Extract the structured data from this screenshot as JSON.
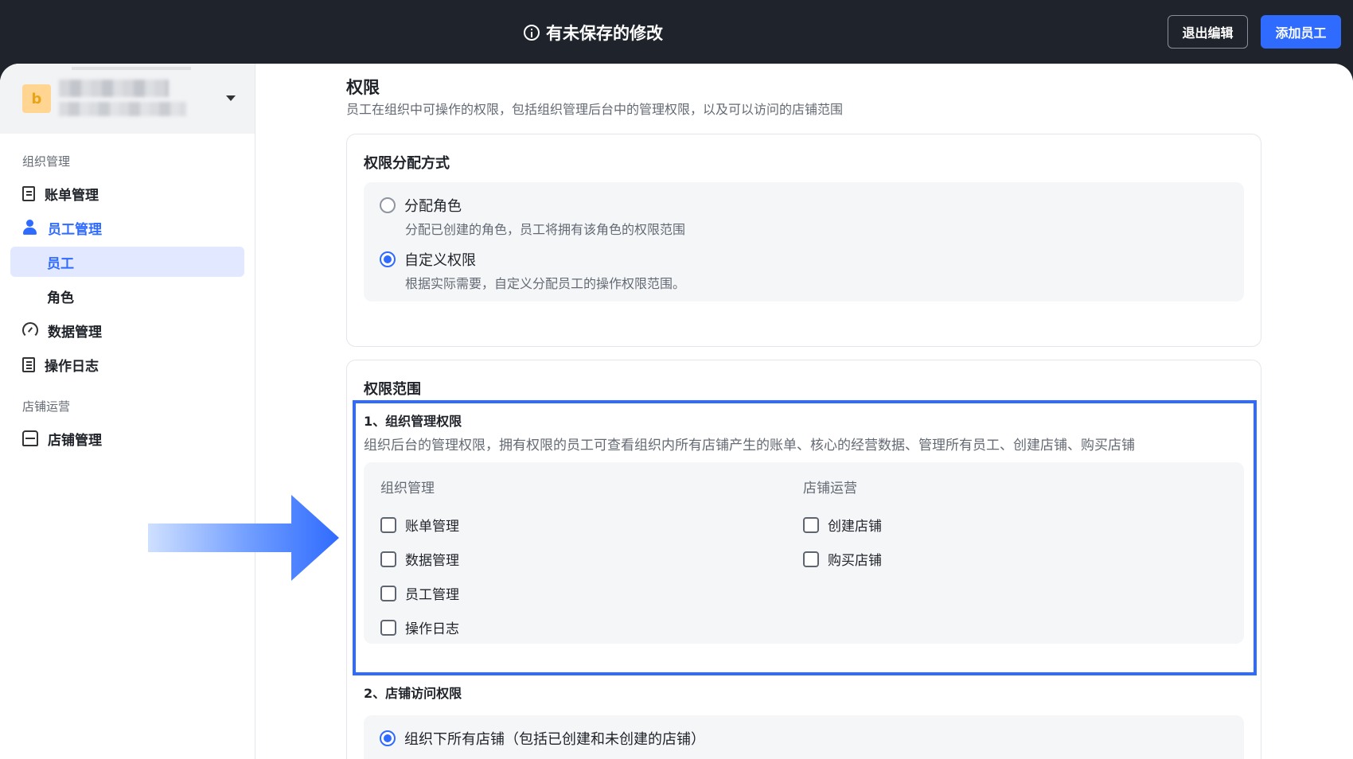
{
  "topbar": {
    "notice": "有未保存的修改",
    "exit_label": "退出编辑",
    "add_label": "添加员工"
  },
  "sidebar": {
    "org_avatar_letter": "b",
    "group_org": "组织管理",
    "items": [
      {
        "label": "账单管理",
        "icon": "bill-icon"
      },
      {
        "label": "员工管理",
        "icon": "user-icon"
      },
      {
        "label": "员工"
      },
      {
        "label": "角色"
      },
      {
        "label": "数据管理",
        "icon": "gauge-icon"
      },
      {
        "label": "操作日志",
        "icon": "log-icon"
      }
    ],
    "group_store": "店铺运营",
    "store_item": {
      "label": "店铺管理",
      "icon": "store-icon"
    }
  },
  "permissions": {
    "title": "权限",
    "desc": "员工在组织中可操作的权限，包括组织管理后台中的管理权限，以及可以访问的店铺范围",
    "assign": {
      "title": "权限分配方式",
      "options": [
        {
          "label": "分配角色",
          "desc": "分配已创建的角色，员工将拥有该角色的权限范围",
          "checked": false
        },
        {
          "label": "自定义权限",
          "desc": "根据实际需要，自定义分配员工的操作权限范围。",
          "checked": true
        }
      ]
    },
    "scope": {
      "title": "权限范围",
      "org_perm_title": "1、组织管理权限",
      "org_perm_desc": "组织后台的管理权限，拥有权限的员工可查看组织内所有店铺产生的账单、核心的经营数据、管理所有员工、创建店铺、购买店铺",
      "col_org": "组织管理",
      "col_store": "店铺运营",
      "org_checks": [
        "账单管理",
        "数据管理",
        "员工管理",
        "操作日志"
      ],
      "store_checks": [
        "创建店铺",
        "购买店铺"
      ],
      "store_access_title": "2、店铺访问权限",
      "store_access_option": "组织下所有店铺（包括已创建和未创建的店铺）"
    }
  },
  "colors": {
    "accent": "#2f6bff",
    "topbar": "#1f242c",
    "highlight": "#2f6bff"
  }
}
